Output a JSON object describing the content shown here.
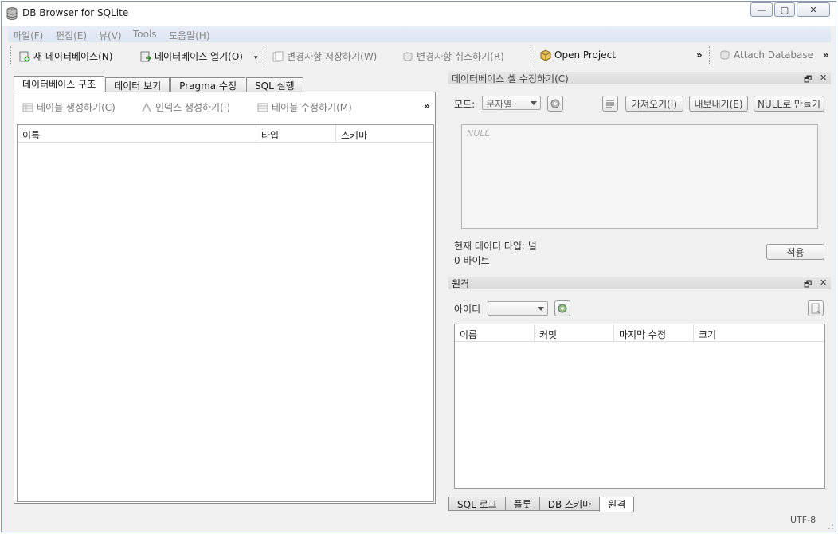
{
  "window": {
    "title": "DB Browser for SQLite",
    "min": "—",
    "max": "▢",
    "close": "✕"
  },
  "menu": [
    "파일(F)",
    "편집(E)",
    "뷰(V)",
    "Tools",
    "도움말(H)"
  ],
  "toolbar": {
    "new_db": "새 데이터베이스(N)",
    "open_db": "데이터베이스 열기(O)",
    "save_changes": "변경사항 저장하기(W)",
    "revert_changes": "변경사항 취소하기(R)",
    "open_project": "Open Project",
    "more": "»",
    "attach_db": "Attach Database",
    "more2": "»"
  },
  "main_tabs": [
    "데이터베이스 구조",
    "데이터 보기",
    "Pragma 수정",
    "SQL 실행"
  ],
  "structure_toolbar": {
    "create_table": "테이블 생성하기(C)",
    "create_index": "인덱스 생성하기(I)",
    "modify_table": "테이블 수정하기(M)",
    "more": "»"
  },
  "structure_columns": [
    "이름",
    "타입",
    "스키마"
  ],
  "edit_cell": {
    "title": "데이터베이스 셀 수정하기(C)",
    "mode_label": "모드:",
    "mode_value": "문자열",
    "import": "가져오기(I)",
    "export": "내보내기(E)",
    "set_null": "NULL로 만들기",
    "placeholder": "NULL",
    "type_info": "현재 데이터 타입: 널",
    "size_info": "0 바이트",
    "apply": "적용"
  },
  "remote": {
    "title": "원격",
    "id_label": "아이디",
    "columns": [
      "이름",
      "커밋",
      "마지막 수정",
      "크기"
    ]
  },
  "bottom_tabs": [
    "SQL 로그",
    "플롯",
    "DB 스키마",
    "원격"
  ],
  "status": {
    "encoding": "UTF-8"
  },
  "dock_controls": {
    "float": "🗗",
    "close": "✕"
  }
}
